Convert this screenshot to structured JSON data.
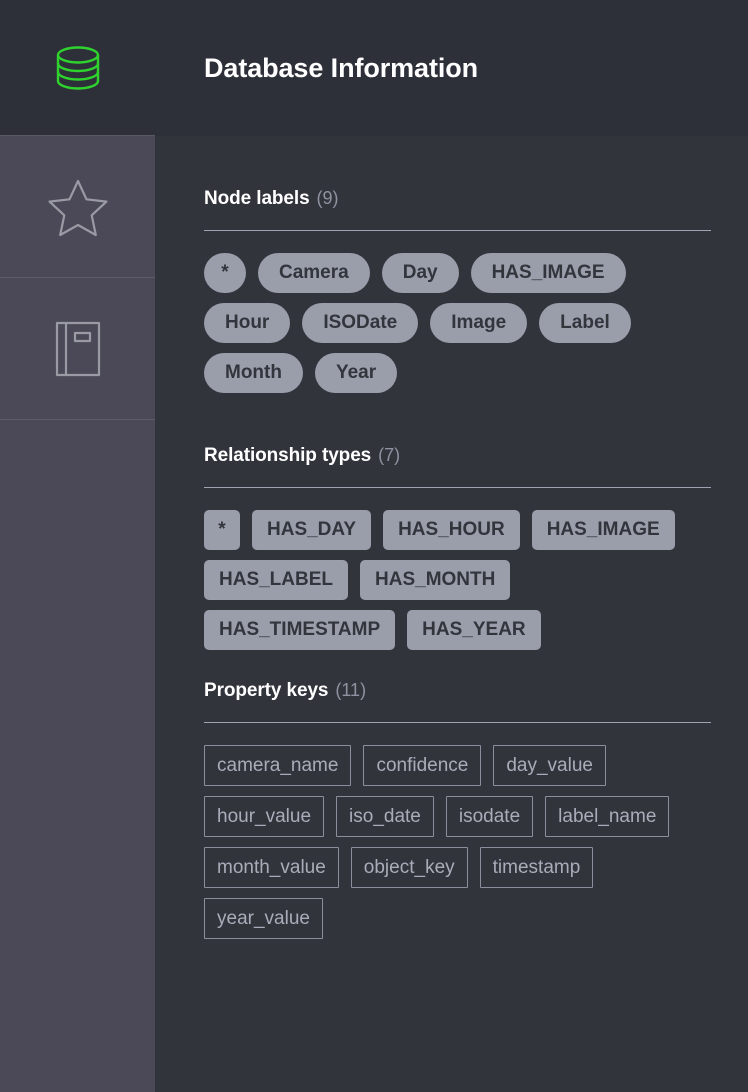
{
  "header": {
    "title": "Database Information"
  },
  "sidebar": {
    "items": [
      {
        "icon": "database-icon",
        "name": "database",
        "active": true
      },
      {
        "icon": "star-icon",
        "name": "favorites",
        "active": false
      },
      {
        "icon": "book-icon",
        "name": "documentation",
        "active": false
      }
    ]
  },
  "colors": {
    "accent_green": "#2ed32e",
    "chip_fill": "#9a9eab",
    "chip_text": "#33353d",
    "outline_chip_text": "#a9adb9",
    "outline_chip_border": "#8a8f9c",
    "header_bg": "#2e3039",
    "main_bg": "#32343c",
    "sidebar_bg": "#4b4957",
    "title_text": "#ffffff",
    "count_text": "#8d93a0",
    "rule": "#9fa3af"
  },
  "sections": [
    {
      "id": "node-labels",
      "title": "Node labels",
      "count": "(9)",
      "chip_style": "pill",
      "chips": [
        "*",
        "Camera",
        "Day",
        "HAS_IMAGE",
        "Hour",
        "ISODate",
        "Image",
        "Label",
        "Month",
        "Year"
      ]
    },
    {
      "id": "relationship-types",
      "title": "Relationship types",
      "count": "(7)",
      "chip_style": "rect",
      "chips": [
        "*",
        "HAS_DAY",
        "HAS_HOUR",
        "HAS_IMAGE",
        "HAS_LABEL",
        "HAS_MONTH",
        "HAS_TIMESTAMP",
        "HAS_YEAR"
      ]
    },
    {
      "id": "property-keys",
      "title": "Property keys",
      "count": "(11)",
      "chip_style": "outline",
      "chips": [
        "camera_name",
        "confidence",
        "day_value",
        "hour_value",
        "iso_date",
        "isodate",
        "label_name",
        "month_value",
        "object_key",
        "timestamp",
        "year_value"
      ]
    }
  ]
}
